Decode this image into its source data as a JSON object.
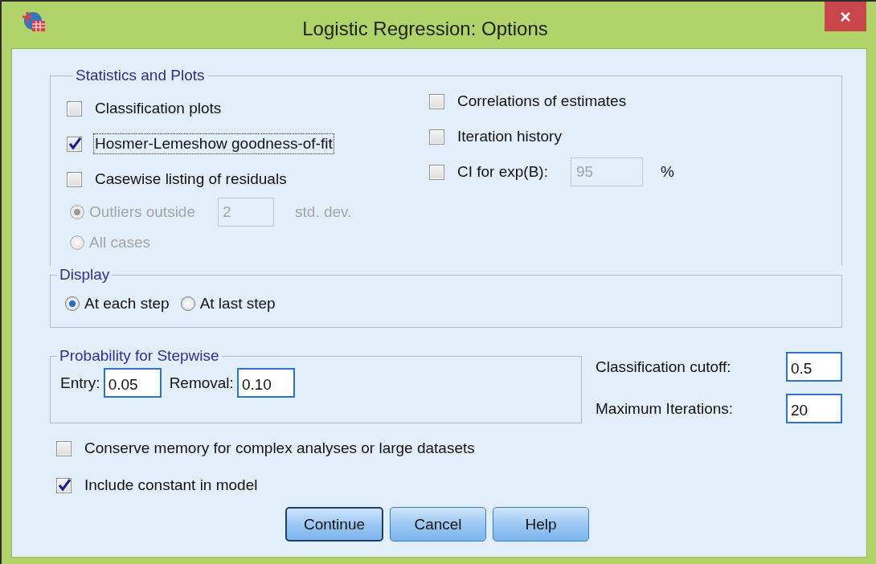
{
  "window": {
    "title": "Logistic Regression: Options"
  },
  "statistics_and_plots": {
    "title": "Statistics and Plots",
    "left_options": [
      {
        "kind": "checkbox",
        "label": "Classification plots",
        "checked": false,
        "focused": false
      },
      {
        "kind": "checkbox",
        "label": "Hosmer-Lemeshow goodness-of-fit",
        "checked": true,
        "focused": true
      },
      {
        "kind": "checkbox",
        "label": "Casewise listing of residuals",
        "checked": false,
        "focused": false
      },
      {
        "kind": "radio",
        "label": "Outliers outside",
        "selected": true,
        "disabled": true,
        "value": "2",
        "unit": "std. dev."
      },
      {
        "kind": "radio",
        "label": "All cases",
        "selected": false,
        "disabled": true
      }
    ],
    "right_options": [
      {
        "kind": "checkbox",
        "label": "Correlations of estimates",
        "checked": false,
        "focused": false
      },
      {
        "kind": "checkbox",
        "label": "Iteration history",
        "checked": false,
        "focused": false
      },
      {
        "kind": "checkbox",
        "label": "CI for exp(B):",
        "checked": false,
        "focused": false,
        "value": "95",
        "value_disabled": true,
        "unit": "%"
      }
    ]
  },
  "display": {
    "title": "Display",
    "options": [
      {
        "label": "At each step",
        "selected": true
      },
      {
        "label": "At last step",
        "selected": false
      }
    ]
  },
  "probability_for_stepwise": {
    "title": "Probability for Stepwise",
    "fields": [
      {
        "label": "Entry:",
        "value": "0.05"
      },
      {
        "label": "Removal:",
        "value": "0.10"
      }
    ]
  },
  "criteria": [
    {
      "label": "Classification cutoff:",
      "value": "0.5"
    },
    {
      "label": "Maximum Iterations:",
      "value": "20"
    }
  ],
  "bottom_options": [
    {
      "kind": "checkbox",
      "label": "Conserve memory for complex analyses or large datasets",
      "checked": false,
      "focused": false
    },
    {
      "kind": "checkbox",
      "label": "Include constant in model",
      "checked": true,
      "focused": false
    }
  ],
  "buttons": [
    {
      "label": "Continue",
      "default": true
    },
    {
      "label": "Cancel",
      "default": false
    },
    {
      "label": "Help",
      "default": false
    }
  ]
}
